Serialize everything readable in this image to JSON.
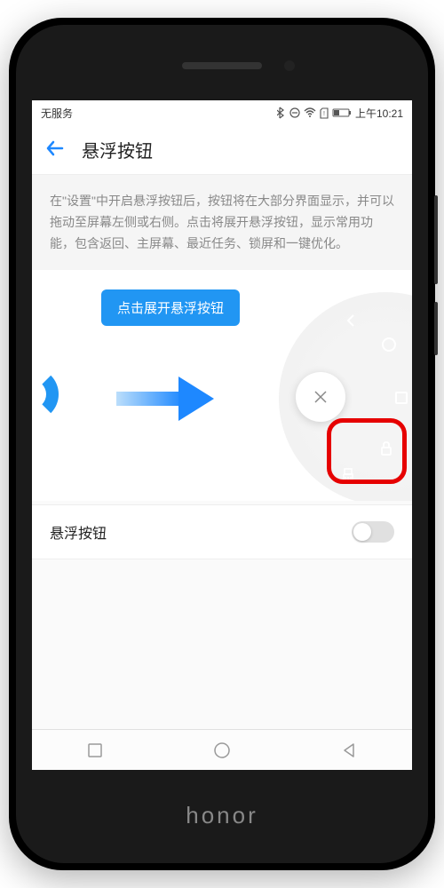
{
  "statusBar": {
    "carrier": "无服务",
    "time": "上午10:21"
  },
  "header": {
    "title": "悬浮按钮"
  },
  "description": "在\"设置\"中开启悬浮按钮后，按钮将在大部分界面显示，并可以拖动至屏幕左侧或右侧。点击将展开悬浮按钮，显示常用功能，包含返回、主屏幕、最近任务、锁屏和一键优化。",
  "tooltip": "点击展开悬浮按钮",
  "setting": {
    "label": "悬浮按钮",
    "enabled": false
  },
  "brand": "honor"
}
